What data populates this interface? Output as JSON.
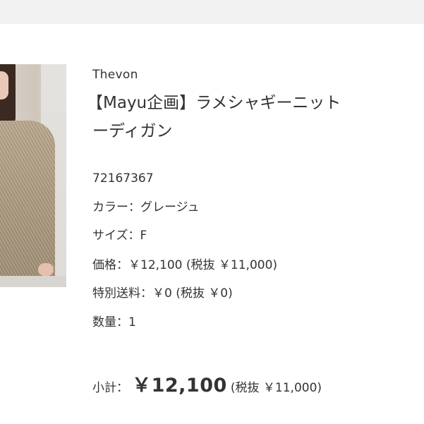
{
  "product": {
    "brand": "Thevon",
    "title_line1": "【Mayu企画】ラメシャギーニット",
    "title_line2": "ーディガン",
    "code": "72167367",
    "color_label": "カラー：",
    "color_value": "グレージュ",
    "size_label": "サイズ：",
    "size_value": "F",
    "price_label": "価格：",
    "price_value": "￥12,100 (税抜 ￥11,000)",
    "shipping_label": "特別送料：",
    "shipping_value": "￥0 (税抜 ￥0)",
    "quantity_label": "数量：",
    "quantity_value": "1"
  },
  "subtotal": {
    "label": "小計：",
    "amount": "￥12,100",
    "tax_note": "(税抜 ￥11,000)"
  },
  "colors": {
    "text": "#333333",
    "top_bar": "#f2f2f2"
  }
}
